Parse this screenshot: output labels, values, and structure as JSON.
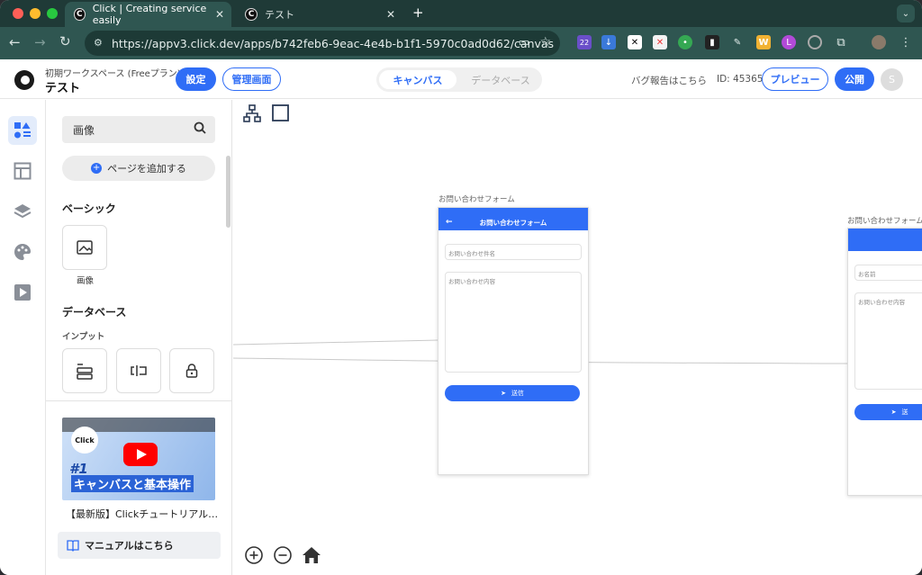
{
  "browser": {
    "tabs": [
      {
        "title": "Click | Creating service easily",
        "favicon": "C"
      },
      {
        "title": "テスト",
        "favicon": "C"
      }
    ],
    "url": "https://appv3.click.dev/apps/b742feb6-9eac-4e4b-b1f1-5970c0ad0d62/canvas",
    "extension_badge": "22"
  },
  "header": {
    "workspace": "初期ワークスペース (Freeプラン)",
    "project": "テスト",
    "settings_label": "設定",
    "admin_label": "管理画面",
    "tabs": [
      "キャンバス",
      "データベース"
    ],
    "bug_report": "バグ報告はこちら",
    "id_text": "ID: 45365",
    "preview_label": "プレビュー",
    "publish_label": "公開",
    "avatar_initial": "S",
    "accent": "#2f6df6"
  },
  "panel": {
    "search_value": "画像",
    "add_page": "ページを追加する",
    "basic_title": "ベーシック",
    "basic_item": "画像",
    "database_title": "データベース",
    "input_title": "インプット",
    "video_title": "【最新版】Clickチュートリアル…",
    "video_thumb_text1": "#1",
    "video_thumb_text2": "キャンバスと基本操作",
    "video_thumb_logo": "Click",
    "manual_label": "マニュアルはこちら"
  },
  "canvas": {
    "screen1": {
      "label": "お問い合わせフォーム",
      "title": "お問い合わせフォーム",
      "field1": "お問い合わせ件名",
      "field2": "お問い合わせ内容",
      "button": "送信"
    },
    "screen2": {
      "label": "お問い合わせフォーム",
      "field1": "お名前",
      "field2": "お問い合わせ内容",
      "button": "送"
    }
  }
}
